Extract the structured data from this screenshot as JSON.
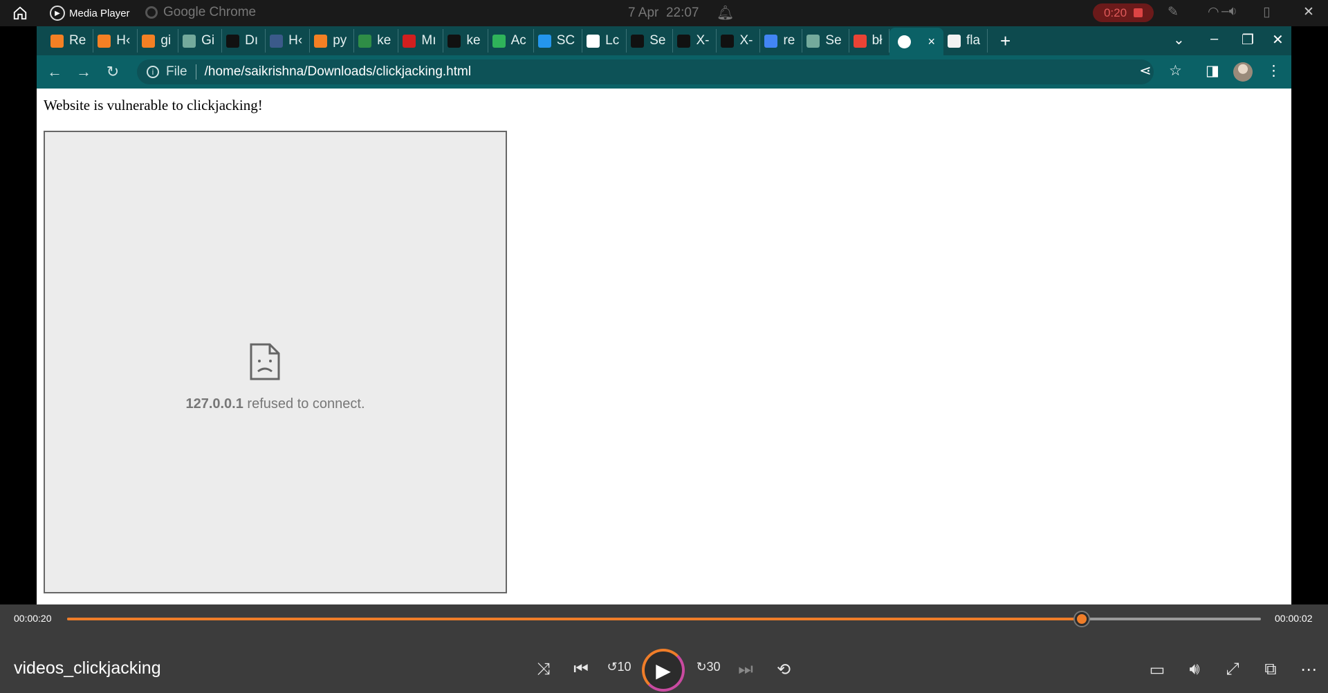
{
  "os_bar": {
    "media_player_label": "Media Player",
    "browser_label": "Google Chrome",
    "date": "7 Apr",
    "time": "22:07",
    "recording_time": "0:20"
  },
  "browser": {
    "tabs": [
      {
        "label": "Re",
        "icon": "stackoverflow-icon",
        "color": "#f48024"
      },
      {
        "label": "H‹",
        "icon": "stackoverflow-icon",
        "color": "#f48024"
      },
      {
        "label": "gi",
        "icon": "stackoverflow-icon",
        "color": "#f48024"
      },
      {
        "label": "Gi",
        "icon": "chatgpt-icon",
        "color": "#74aa9c"
      },
      {
        "label": "Dı",
        "icon": "github-icon",
        "color": "#111111"
      },
      {
        "label": "H‹",
        "icon": "doc-icon",
        "color": "#3b5a8a"
      },
      {
        "label": "py",
        "icon": "stackoverflow-icon",
        "color": "#f48024"
      },
      {
        "label": "ke",
        "icon": "gfg-icon",
        "color": "#2f8d46"
      },
      {
        "label": "Mı",
        "icon": "k-icon",
        "color": "#d11f1f"
      },
      {
        "label": "ke",
        "icon": "github-icon",
        "color": "#111111"
      },
      {
        "label": "Ac",
        "icon": "diamond-icon",
        "color": "#2fb35a"
      },
      {
        "label": "SC",
        "icon": "docker-icon",
        "color": "#2496ed"
      },
      {
        "label": "Lc",
        "icon": "globe-icon",
        "color": "#ffffff"
      },
      {
        "label": "Se",
        "icon": "phone-icon",
        "color": "#111111"
      },
      {
        "label": "X-",
        "icon": "medium-icon",
        "color": "#111111"
      },
      {
        "label": "X-",
        "icon": "medium-icon",
        "color": "#111111"
      },
      {
        "label": "re",
        "icon": "google-icon",
        "color": "#4285f4"
      },
      {
        "label": "Se",
        "icon": "chatgpt-icon",
        "color": "#74aa9c"
      },
      {
        "label": "bł",
        "icon": "gmail-icon",
        "color": "#ea4335"
      }
    ],
    "active_tab_close": "×",
    "after_tab": {
      "label": "fla",
      "icon": "cube-icon"
    },
    "new_tab": "+",
    "address_scheme": "File",
    "address_path": "/home/saikrishna/Downloads/clickjacking.html"
  },
  "page": {
    "message": "Website is vulnerable to clickjacking!",
    "frame_host": "127.0.0.1",
    "frame_error": " refused to connect."
  },
  "player": {
    "elapsed": "00:00:20",
    "remaining": "00:00:02",
    "progress": 0.85,
    "title": "videos_clickjacking",
    "accent": "#ef7d29"
  }
}
